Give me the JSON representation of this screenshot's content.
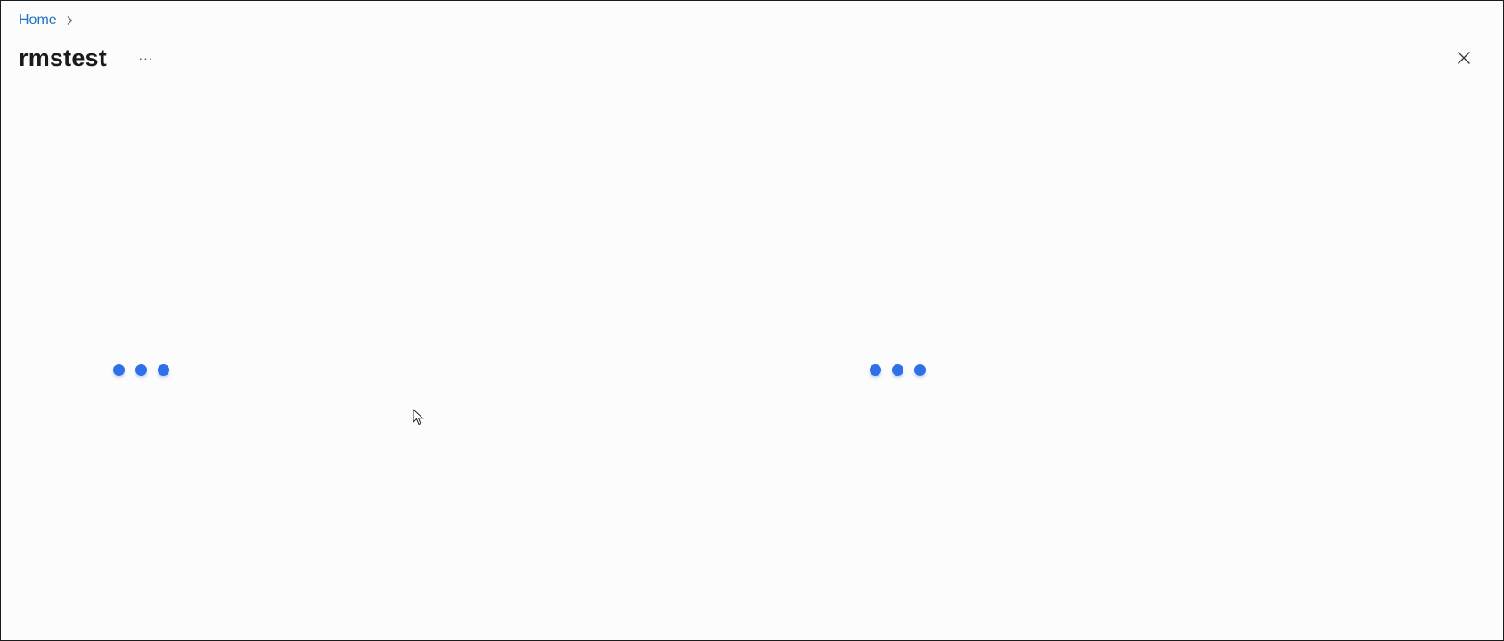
{
  "breadcrumb": {
    "home_label": "Home"
  },
  "header": {
    "title": "rmstest",
    "more_label": "···"
  },
  "colors": {
    "link": "#1f72c4",
    "loader_dot": "#2f6fe8",
    "title_text": "#1b1b1b",
    "background": "#fcfcfc"
  },
  "icons": {
    "breadcrumb_separator": "chevron-right-icon",
    "close": "close-icon",
    "more": "more-icon",
    "loading": "loading-dots-icon",
    "pointer": "mouse-cursor-icon"
  }
}
